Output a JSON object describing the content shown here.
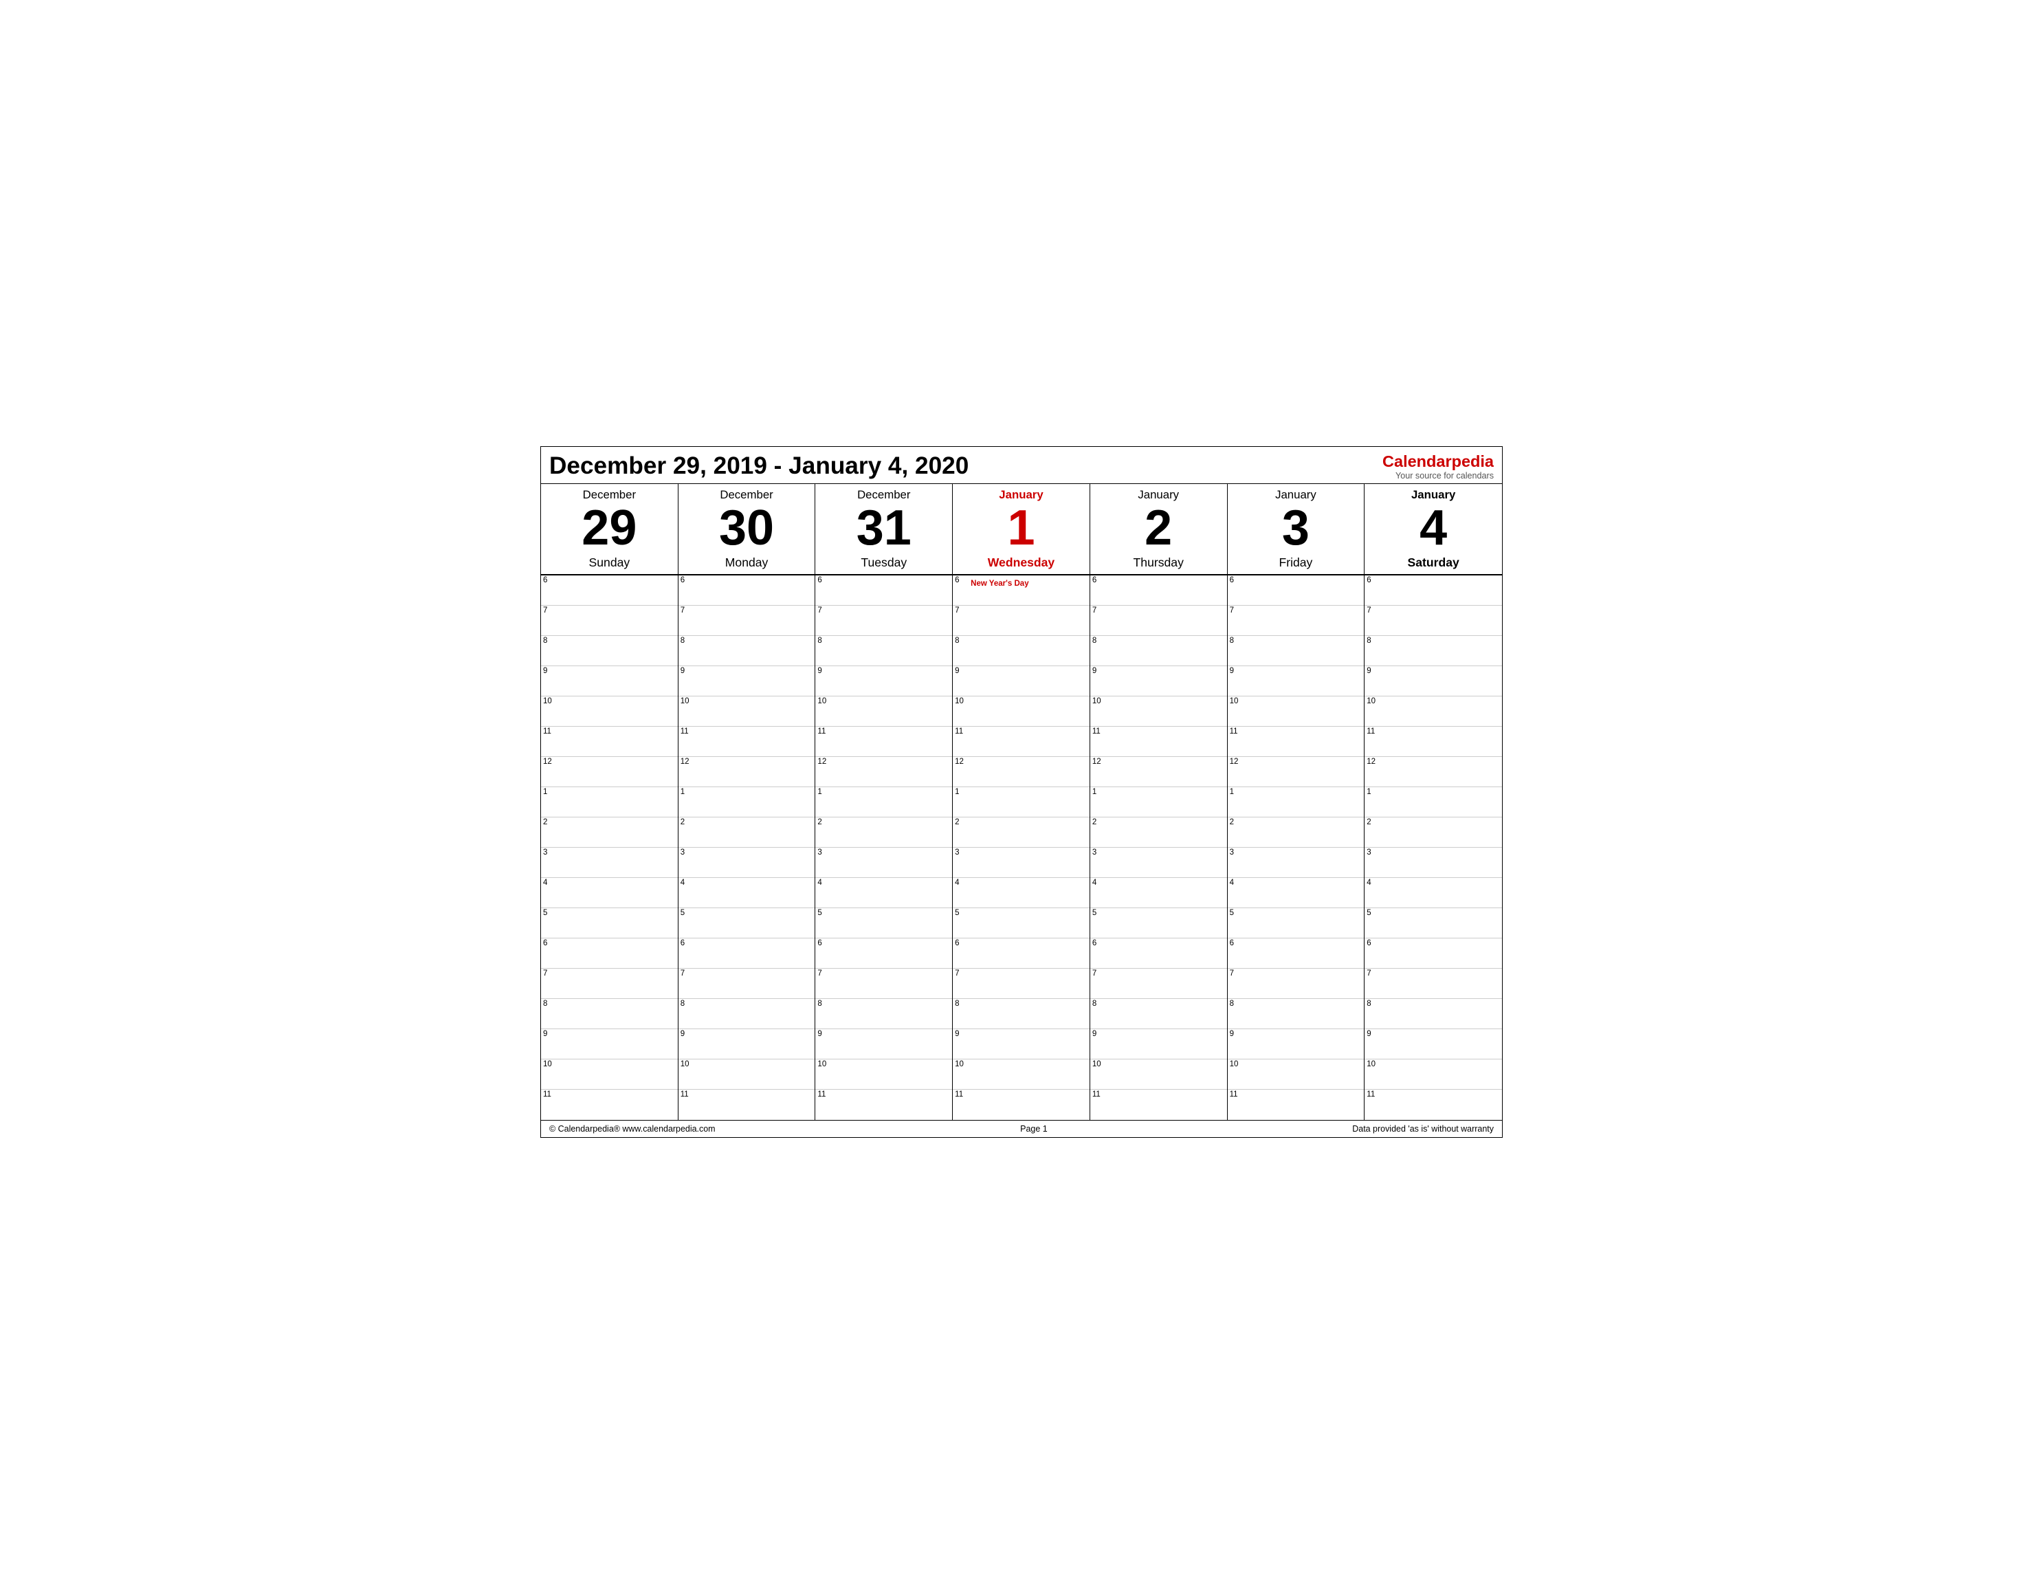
{
  "header": {
    "title": "December 29, 2019 - January 4, 2020",
    "brand_main_pre": "Calendar",
    "brand_main_post": "pedia",
    "brand_sub": "Your source for calendars"
  },
  "days": [
    {
      "month": "December",
      "number": "29",
      "name": "Sunday",
      "highlight": false,
      "bold_last": false
    },
    {
      "month": "December",
      "number": "30",
      "name": "Monday",
      "highlight": false,
      "bold_last": false
    },
    {
      "month": "December",
      "number": "31",
      "name": "Tuesday",
      "highlight": false,
      "bold_last": false
    },
    {
      "month": "January",
      "number": "1",
      "name": "Wednesday",
      "highlight": true,
      "bold_last": false
    },
    {
      "month": "January",
      "number": "2",
      "name": "Thursday",
      "highlight": false,
      "bold_last": false
    },
    {
      "month": "January",
      "number": "3",
      "name": "Friday",
      "highlight": false,
      "bold_last": false
    },
    {
      "month": "January",
      "number": "4",
      "name": "Saturday",
      "highlight": false,
      "bold_last": true
    }
  ],
  "time_slots": [
    {
      "label": "6"
    },
    {
      "label": "7"
    },
    {
      "label": "8"
    },
    {
      "label": "9"
    },
    {
      "label": "10"
    },
    {
      "label": "11"
    },
    {
      "label": "12"
    },
    {
      "label": "1"
    },
    {
      "label": "2"
    },
    {
      "label": "3"
    },
    {
      "label": "4"
    },
    {
      "label": "5"
    },
    {
      "label": "6"
    },
    {
      "label": "7"
    },
    {
      "label": "8"
    },
    {
      "label": "9"
    },
    {
      "label": "10"
    },
    {
      "label": "11"
    }
  ],
  "holiday": {
    "day_index": 3,
    "slot_index": 0,
    "text": "New Year's Day"
  },
  "footer": {
    "left": "© Calendarpedia®   www.calendarpedia.com",
    "center": "Page 1",
    "right": "Data provided 'as is' without warranty"
  }
}
